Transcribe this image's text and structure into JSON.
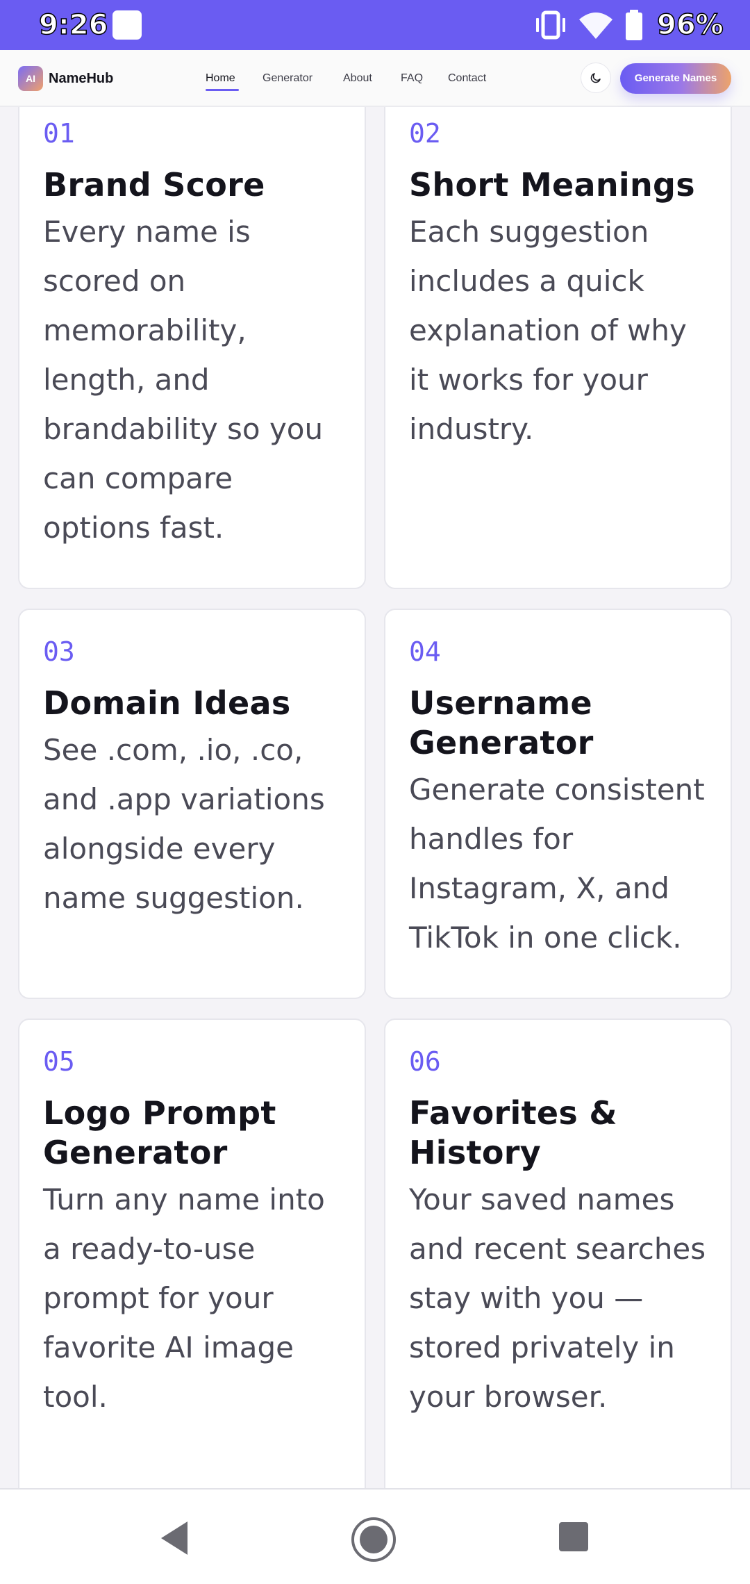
{
  "status_bar": {
    "time": "9:26",
    "battery_percent": "96%",
    "background_color": "#6a5cf2",
    "icons": [
      "app-notification-icon",
      "vibrate-icon",
      "wifi-icon",
      "battery-icon"
    ]
  },
  "header": {
    "logo_badge": "AI",
    "brand": "NameHub",
    "nav": [
      {
        "label": "Home",
        "active": true
      },
      {
        "label": "Generator",
        "active": false
      },
      {
        "label": "About",
        "active": false
      },
      {
        "label": "FAQ",
        "active": false
      },
      {
        "label": "Contact",
        "active": false
      }
    ],
    "theme_toggle_icon": "moon-icon",
    "cta_label": "Generate Names",
    "accent_color": "#6a5cf2"
  },
  "features": [
    {
      "number": "01",
      "title": "Brand Score",
      "description": "Every name is scored on memorability, length, and brandability so you can compare options fast."
    },
    {
      "number": "02",
      "title": "Short Meanings",
      "description": "Each suggestion includes a quick explanation of why it works for your industry."
    },
    {
      "number": "03",
      "title": "Domain Ideas",
      "description": "See .com, .io, .co, and .app variations alongside every name suggestion."
    },
    {
      "number": "04",
      "title": "Username Generator",
      "description": "Generate consistent handles for Instagram, X, and TikTok in one click."
    },
    {
      "number": "05",
      "title": "Logo Prompt Generator",
      "description": "Turn any name into a ready-to-use prompt for your favorite AI image tool."
    },
    {
      "number": "06",
      "title": "Favorites & History",
      "description": "Your saved names and recent searches stay with you — stored privately in your browser."
    }
  ],
  "system_nav": {
    "buttons": [
      "back-icon",
      "home-icon",
      "recents-icon"
    ]
  }
}
